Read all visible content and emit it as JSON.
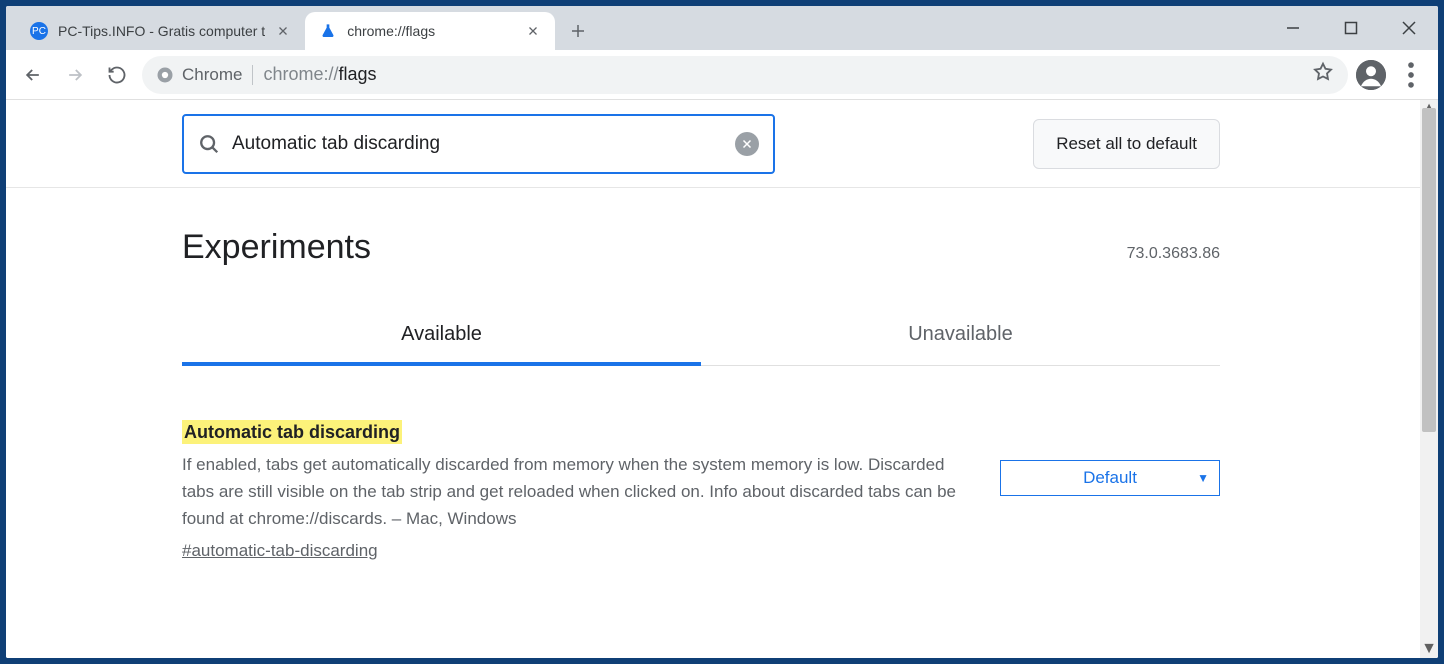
{
  "tabs": [
    {
      "title": "PC-Tips.INFO - Gratis computer t",
      "active": false
    },
    {
      "title": "chrome://flags",
      "active": true
    }
  ],
  "omnibox": {
    "chip": "Chrome",
    "scheme": "chrome://",
    "path": "flags"
  },
  "page": {
    "search_value": "Automatic tab discarding",
    "reset_button": "Reset all to default",
    "heading": "Experiments",
    "version": "73.0.3683.86",
    "tab_available": "Available",
    "tab_unavailable": "Unavailable",
    "flag": {
      "title": "Automatic tab discarding",
      "description": "If enabled, tabs get automatically discarded from memory when the system memory is low. Discarded tabs are still visible on the tab strip and get reloaded when clicked on. Info about discarded tabs can be found at chrome://discards. – Mac, Windows",
      "anchor": "#automatic-tab-discarding",
      "select_value": "Default"
    }
  }
}
